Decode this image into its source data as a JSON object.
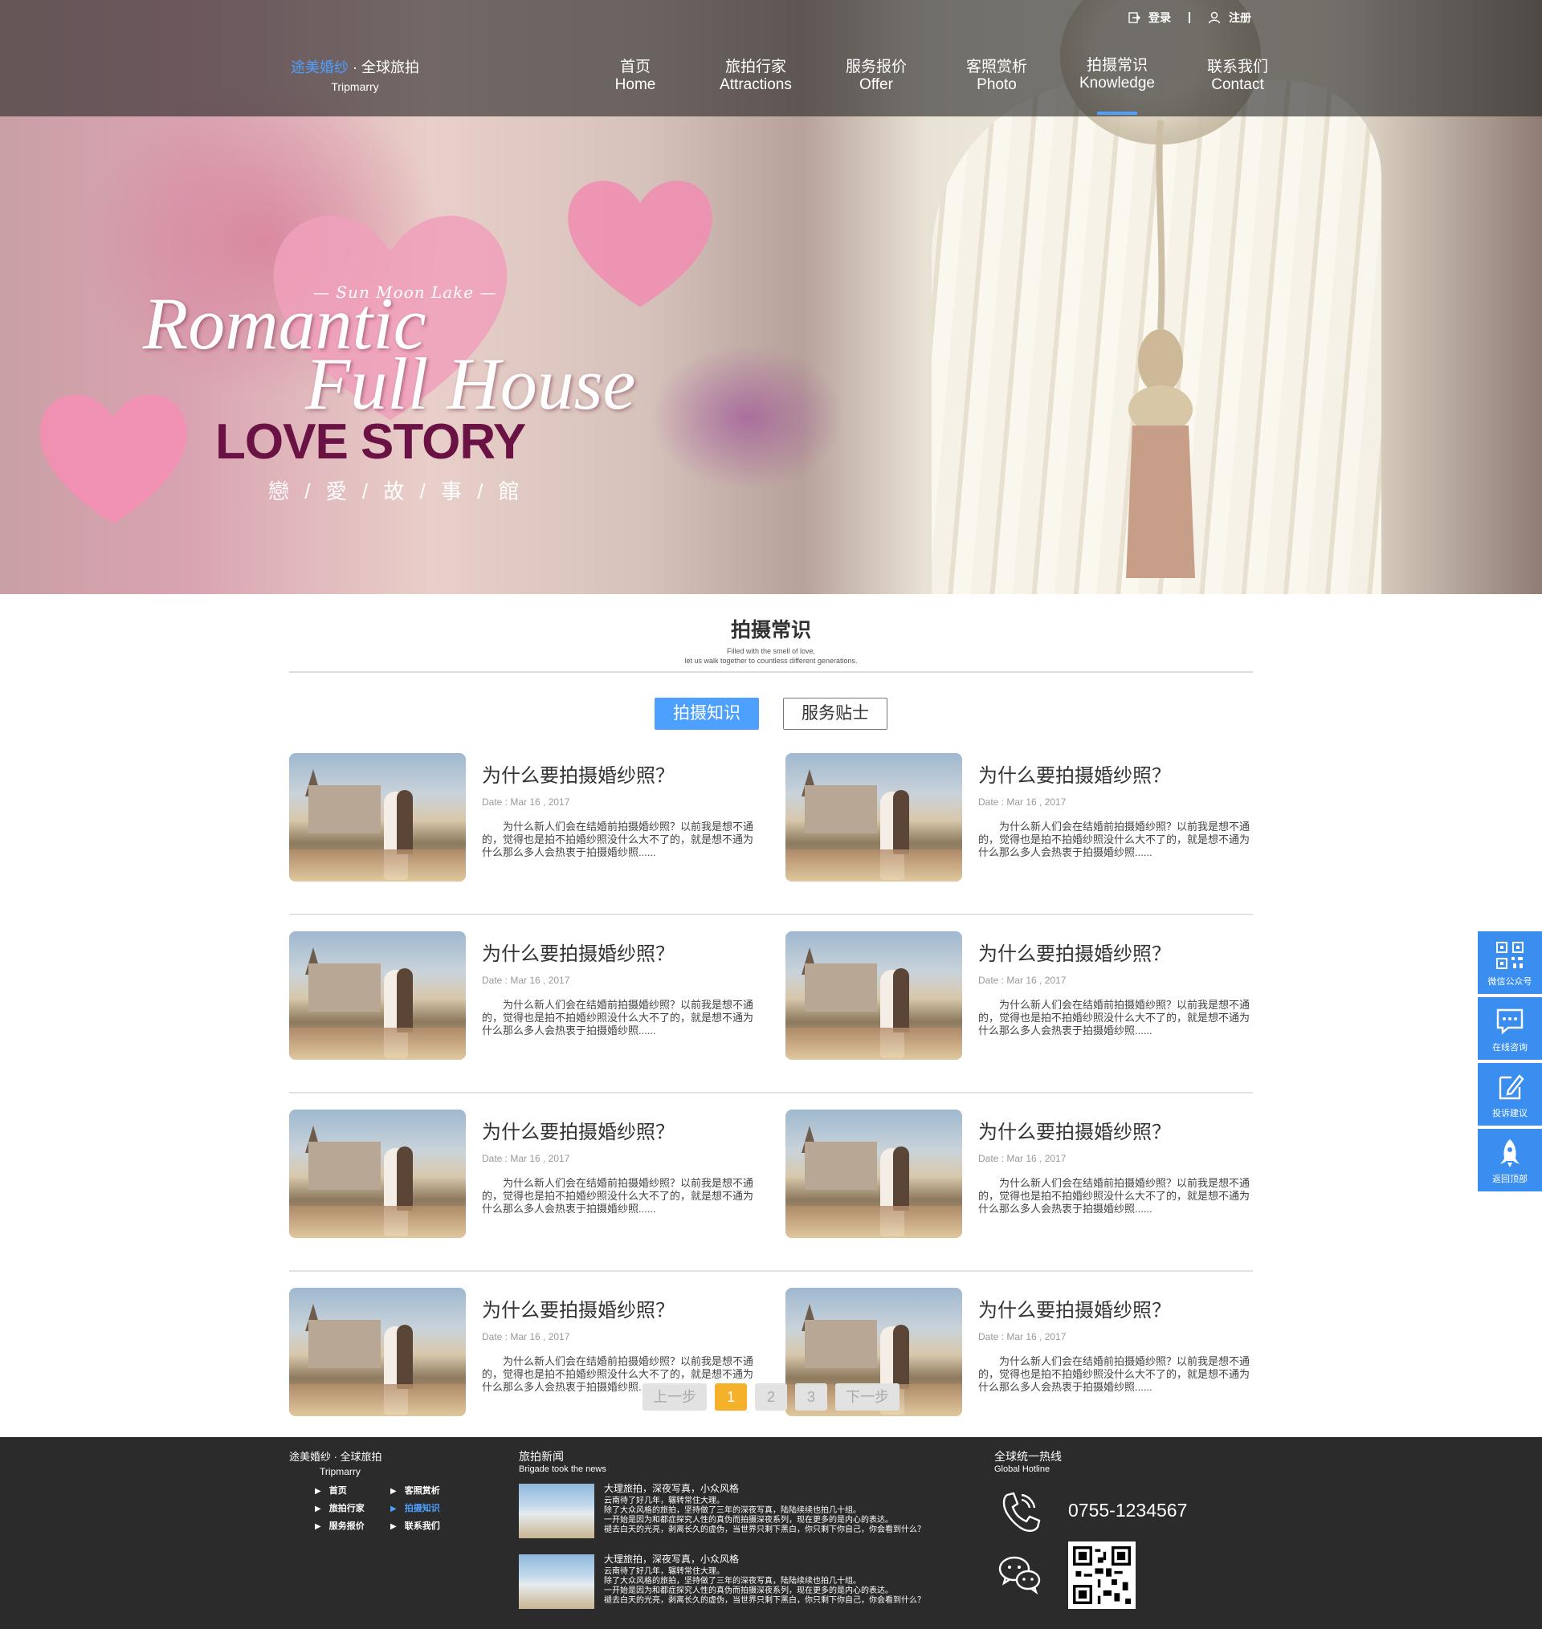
{
  "brand": {
    "name_blue": "途美婚纱",
    "name_rest": " · 全球旅拍",
    "sub": "Tripmarry"
  },
  "topbar": {
    "login": "登录",
    "register": "注册"
  },
  "nav": [
    {
      "zh": "首页",
      "en": "Home"
    },
    {
      "zh": "旅拍行家",
      "en": "Attractions"
    },
    {
      "zh": "服务报价",
      "en": "Offer"
    },
    {
      "zh": "客照赏析",
      "en": "Photo"
    },
    {
      "zh": "拍摄常识",
      "en": "Knowledge"
    },
    {
      "zh": "联系我们",
      "en": "Contact"
    }
  ],
  "hero": {
    "line1": "— Sun Moon Lake —",
    "line2": "Romantic",
    "line3": "Full House",
    "line4": "LOVE STORY",
    "line5": "戀 / 愛 / 故 / 事 / 館"
  },
  "section": {
    "title": "拍摄常识",
    "sub1": "Filled with the smell of love,",
    "sub2": "let us walk together to countless different generations."
  },
  "tabs": [
    "拍摄知识",
    "服务贴士"
  ],
  "articles": [
    {
      "title": "为什么要拍摄婚纱照？",
      "date": "Date : Mar 16 , 2017",
      "desc": "为什么新人们会在结婚前拍摄婚纱照？以前我是想不通的，觉得也是拍不拍婚纱照没什么大不了的，就是想不通为什么那么多人会热衷于拍摄婚纱照......"
    },
    {
      "title": "为什么要拍摄婚纱照？",
      "date": "Date : Mar 16 , 2017",
      "desc": "为什么新人们会在结婚前拍摄婚纱照？以前我是想不通的，觉得也是拍不拍婚纱照没什么大不了的，就是想不通为什么那么多人会热衷于拍摄婚纱照......"
    },
    {
      "title": "为什么要拍摄婚纱照？",
      "date": "Date : Mar 16 , 2017",
      "desc": "为什么新人们会在结婚前拍摄婚纱照？以前我是想不通的，觉得也是拍不拍婚纱照没什么大不了的，就是想不通为什么那么多人会热衷于拍摄婚纱照......"
    },
    {
      "title": "为什么要拍摄婚纱照？",
      "date": "Date : Mar 16 , 2017",
      "desc": "为什么新人们会在结婚前拍摄婚纱照？以前我是想不通的，觉得也是拍不拍婚纱照没什么大不了的，就是想不通为什么那么多人会热衷于拍摄婚纱照......"
    },
    {
      "title": "为什么要拍摄婚纱照？",
      "date": "Date : Mar 16 , 2017",
      "desc": "为什么新人们会在结婚前拍摄婚纱照？以前我是想不通的，觉得也是拍不拍婚纱照没什么大不了的，就是想不通为什么那么多人会热衷于拍摄婚纱照......"
    },
    {
      "title": "为什么要拍摄婚纱照？",
      "date": "Date : Mar 16 , 2017",
      "desc": "为什么新人们会在结婚前拍摄婚纱照？以前我是想不通的，觉得也是拍不拍婚纱照没什么大不了的，就是想不通为什么那么多人会热衷于拍摄婚纱照......"
    },
    {
      "title": "为什么要拍摄婚纱照？",
      "date": "Date : Mar 16 , 2017",
      "desc": "为什么新人们会在结婚前拍摄婚纱照？以前我是想不通的，觉得也是拍不拍婚纱照没什么大不了的，就是想不通为什么那么多人会热衷于拍摄婚纱照......"
    },
    {
      "title": "为什么要拍摄婚纱照？",
      "date": "Date : Mar 16 , 2017",
      "desc": "为什么新人们会在结婚前拍摄婚纱照？以前我是想不通的，觉得也是拍不拍婚纱照没什么大不了的，就是想不通为什么那么多人会热衷于拍摄婚纱照......"
    }
  ],
  "pager": {
    "prev": "上一步",
    "pages": [
      "1",
      "2",
      "3"
    ],
    "current": "1",
    "next": "下一步"
  },
  "side": [
    "微信公众号",
    "在线咨询",
    "投诉建议",
    "返回顶部"
  ],
  "footer": {
    "logo": "途美婚纱 · 全球旅拍",
    "logo_sub": "Tripmarry",
    "links": [
      "首页",
      "客照赏析",
      "旅拍行家",
      "拍摄知识",
      "服务报价",
      "联系我们"
    ],
    "news_title": "旅拍新闻",
    "news_sub": "Brigade took the news",
    "news": [
      {
        "title": "大理旅拍，深夜写真，小众风格",
        "l1": "云南待了好几年，辗转常住大理。",
        "l2": "除了大众风格的旅拍，坚持做了三年的深夜写真，陆陆续续也拍几十组。",
        "l3": "一开始是因为和都症探究人性的真伪而拍摄深夜系列，现在更多的是内心的表达。",
        "l4": "褪去白天的光亮，剥离长久的虚伪，当世界只剩下黑白，你只剩下你自己，你会看到什么？"
      },
      {
        "title": "大理旅拍，深夜写真，小众风格",
        "l1": "云南待了好几年，辗转常住大理。",
        "l2": "除了大众风格的旅拍，坚持做了三年的深夜写真，陆陆续续也拍几十组。",
        "l3": "一开始是因为和都症探究人性的真伪而拍摄深夜系列，现在更多的是内心的表达。",
        "l4": "褪去白天的光亮，剥离长久的虚伪，当世界只剩下黑白，你只剩下你自己，你会看到什么？"
      }
    ],
    "hotline_title": "全球统一热线",
    "hotline_sub": "Global Hotline",
    "phone": "0755-1234567"
  },
  "colors": {
    "accent": "#4ea0ff",
    "pager_current": "#f5b12a",
    "footer_bg": "#2b2b2b",
    "side_bg": "#3a8ef0",
    "love_story": "#6b1245"
  }
}
